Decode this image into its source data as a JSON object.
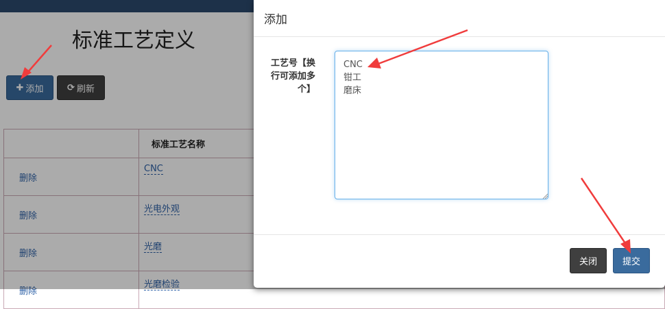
{
  "background_page": {
    "title": "标准工艺定义",
    "toolbar": {
      "add_label": "添加",
      "refresh_label": "刷新"
    },
    "table": {
      "header_col2": "标准工艺名称",
      "rows": [
        {
          "action": "删除",
          "name": "CNC"
        },
        {
          "action": "删除",
          "name": "光电外观"
        },
        {
          "action": "删除",
          "name": "光磨"
        },
        {
          "action": "删除",
          "name": "光磨检验"
        }
      ]
    }
  },
  "modal": {
    "title": "添加",
    "field_label": "工艺号【换行可添加多个】",
    "field_value": "CNC\n钳工\n磨床",
    "close_label": "关闭",
    "submit_label": "提交"
  },
  "colors": {
    "primary": "#3a6b9d",
    "dark": "#3f3f3f",
    "annotation_arrow": "#f03c3c"
  }
}
